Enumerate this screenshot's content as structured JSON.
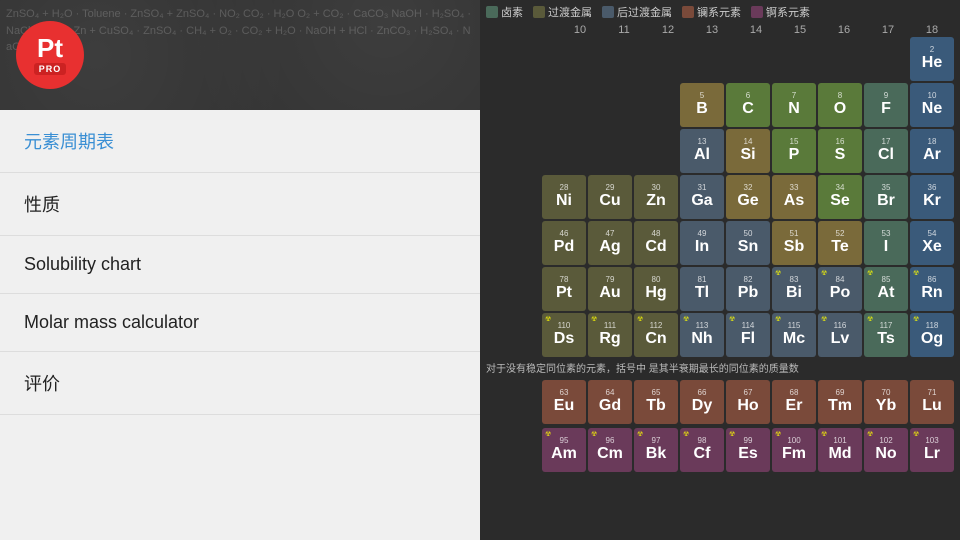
{
  "app": {
    "logo_symbol": "Pt",
    "logo_pro": "PRO"
  },
  "sidebar": {
    "nav_items": [
      {
        "label": "元素周期表",
        "active": true
      },
      {
        "label": "性质",
        "active": false
      },
      {
        "label": "Solubility chart",
        "active": false
      },
      {
        "label": "Molar mass calculator",
        "active": false
      },
      {
        "label": "评价",
        "active": false
      }
    ]
  },
  "legend": {
    "items": [
      {
        "label": "卤素",
        "color": "#4a6a5a"
      },
      {
        "label": "过渡金属",
        "color": "#5a5a3a"
      },
      {
        "label": "后过渡金属",
        "color": "#4a5a6a"
      },
      {
        "label": "镧系元素",
        "color": "#7a4a3a"
      },
      {
        "label": "锕系元素",
        "color": "#6a3a5a"
      }
    ]
  },
  "group_numbers": [
    "10",
    "11",
    "12",
    "13",
    "14",
    "15",
    "16",
    "17",
    "18"
  ],
  "note": "对于没有稳定同位素的元素，括号中 是其半衰期最长的同位素的质量数",
  "elements": {
    "row1": [
      {
        "num": "2",
        "sym": "He",
        "cls": "c-noble"
      }
    ],
    "row2": [
      {
        "num": "5",
        "sym": "B",
        "cls": "c-boron"
      },
      {
        "num": "6",
        "sym": "C",
        "cls": "c-nonmetal"
      },
      {
        "num": "7",
        "sym": "N",
        "cls": "c-nonmetal"
      },
      {
        "num": "8",
        "sym": "O",
        "cls": "c-nonmetal"
      },
      {
        "num": "9",
        "sym": "F",
        "cls": "c-halogen"
      },
      {
        "num": "10",
        "sym": "Ne",
        "cls": "c-noble"
      }
    ],
    "row3": [
      {
        "num": "13",
        "sym": "Al",
        "cls": "c-post-transition"
      },
      {
        "num": "14",
        "sym": "Si",
        "cls": "c-boron"
      },
      {
        "num": "15",
        "sym": "P",
        "cls": "c-nonmetal"
      },
      {
        "num": "16",
        "sym": "S",
        "cls": "c-nonmetal"
      },
      {
        "num": "17",
        "sym": "Cl",
        "cls": "c-halogen"
      },
      {
        "num": "18",
        "sym": "Ar",
        "cls": "c-noble"
      }
    ],
    "row4": [
      {
        "num": "28",
        "sym": "Ni",
        "cls": "c-transition"
      },
      {
        "num": "29",
        "sym": "Cu",
        "cls": "c-transition"
      },
      {
        "num": "30",
        "sym": "Zn",
        "cls": "c-transition"
      },
      {
        "num": "31",
        "sym": "Ga",
        "cls": "c-post-transition"
      },
      {
        "num": "32",
        "sym": "Ge",
        "cls": "c-boron"
      },
      {
        "num": "33",
        "sym": "As",
        "cls": "c-boron"
      },
      {
        "num": "34",
        "sym": "Se",
        "cls": "c-nonmetal"
      },
      {
        "num": "35",
        "sym": "Br",
        "cls": "c-halogen"
      },
      {
        "num": "36",
        "sym": "Kr",
        "cls": "c-noble"
      }
    ],
    "row5": [
      {
        "num": "46",
        "sym": "Pd",
        "cls": "c-transition"
      },
      {
        "num": "47",
        "sym": "Ag",
        "cls": "c-transition"
      },
      {
        "num": "48",
        "sym": "Cd",
        "cls": "c-transition"
      },
      {
        "num": "49",
        "sym": "In",
        "cls": "c-post-transition"
      },
      {
        "num": "50",
        "sym": "Sn",
        "cls": "c-post-transition"
      },
      {
        "num": "51",
        "sym": "Sb",
        "cls": "c-boron"
      },
      {
        "num": "52",
        "sym": "Te",
        "cls": "c-boron"
      },
      {
        "num": "53",
        "sym": "I",
        "cls": "c-halogen"
      },
      {
        "num": "54",
        "sym": "Xe",
        "cls": "c-noble"
      }
    ],
    "row6": [
      {
        "num": "78",
        "sym": "Pt",
        "cls": "c-transition"
      },
      {
        "num": "79",
        "sym": "Au",
        "cls": "c-transition"
      },
      {
        "num": "80",
        "sym": "Hg",
        "cls": "c-transition"
      },
      {
        "num": "81",
        "sym": "Tl",
        "cls": "c-post-transition"
      },
      {
        "num": "82",
        "sym": "Pb",
        "cls": "c-post-transition"
      },
      {
        "num": "83",
        "sym": "Bi",
        "cls": "c-post-transition",
        "radio": true
      },
      {
        "num": "84",
        "sym": "Po",
        "cls": "c-post-transition",
        "radio": true
      },
      {
        "num": "85",
        "sym": "At",
        "cls": "c-halogen",
        "radio": true
      },
      {
        "num": "86",
        "sym": "Rn",
        "cls": "c-noble",
        "radio": true
      }
    ],
    "row7": [
      {
        "num": "110",
        "sym": "Ds",
        "cls": "c-transition",
        "radio": true
      },
      {
        "num": "111",
        "sym": "Rg",
        "cls": "c-transition",
        "radio": true
      },
      {
        "num": "112",
        "sym": "Cn",
        "cls": "c-transition",
        "radio": true
      },
      {
        "num": "113",
        "sym": "Nh",
        "cls": "c-post-transition",
        "radio": true
      },
      {
        "num": "114",
        "sym": "Fl",
        "cls": "c-post-transition",
        "radio": true
      },
      {
        "num": "115",
        "sym": "Mc",
        "cls": "c-post-transition",
        "radio": true
      },
      {
        "num": "116",
        "sym": "Lv",
        "cls": "c-post-transition",
        "radio": true
      },
      {
        "num": "117",
        "sym": "Ts",
        "cls": "c-halogen",
        "radio": true
      },
      {
        "num": "118",
        "sym": "Og",
        "cls": "c-noble",
        "radio": true
      }
    ],
    "lanthanide": [
      {
        "num": "63",
        "sym": "Eu",
        "cls": "c-lanthanide"
      },
      {
        "num": "64",
        "sym": "Gd",
        "cls": "c-lanthanide"
      },
      {
        "num": "65",
        "sym": "Tb",
        "cls": "c-lanthanide"
      },
      {
        "num": "66",
        "sym": "Dy",
        "cls": "c-lanthanide"
      },
      {
        "num": "67",
        "sym": "Ho",
        "cls": "c-lanthanide"
      },
      {
        "num": "68",
        "sym": "Er",
        "cls": "c-lanthanide"
      },
      {
        "num": "69",
        "sym": "Tm",
        "cls": "c-lanthanide"
      },
      {
        "num": "70",
        "sym": "Yb",
        "cls": "c-lanthanide"
      },
      {
        "num": "71",
        "sym": "Lu",
        "cls": "c-lanthanide"
      }
    ],
    "actinide": [
      {
        "num": "95",
        "sym": "Am",
        "cls": "c-actinide",
        "radio": true
      },
      {
        "num": "96",
        "sym": "Cm",
        "cls": "c-actinide",
        "radio": true
      },
      {
        "num": "97",
        "sym": "Bk",
        "cls": "c-actinide",
        "radio": true
      },
      {
        "num": "98",
        "sym": "Cf",
        "cls": "c-actinide",
        "radio": true
      },
      {
        "num": "99",
        "sym": "Es",
        "cls": "c-actinide",
        "radio": true
      },
      {
        "num": "100",
        "sym": "Fm",
        "cls": "c-actinide",
        "radio": true
      },
      {
        "num": "101",
        "sym": "Md",
        "cls": "c-actinide",
        "radio": true
      },
      {
        "num": "102",
        "sym": "No",
        "cls": "c-actinide",
        "radio": true
      },
      {
        "num": "103",
        "sym": "Lr",
        "cls": "c-actinide",
        "radio": true
      }
    ]
  }
}
